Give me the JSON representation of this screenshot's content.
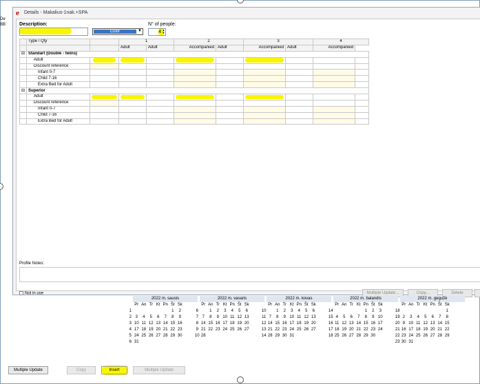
{
  "dialog": {
    "title": "Details - Makalius-1nak.+SPA",
    "description_label": "Description:",
    "description_value": "",
    "color_label": "Color",
    "people_label": "N° of people:",
    "people_value": "4"
  },
  "side": {
    "line1": "De",
    "line2": "BB"
  },
  "grid": {
    "type_qty": "Type / Qty",
    "cols": [
      "1",
      "2",
      "3",
      "4"
    ],
    "sub": [
      "Adult",
      "Adult",
      "Accompanied",
      "Adult",
      "Accompanied",
      "Adult",
      "Accompanied"
    ],
    "sections": [
      {
        "name": "Standart (Double - twins)",
        "rows": [
          "Adult",
          "Discount reference",
          "Infant 0-7",
          "Child 7-16",
          "Extra Bed for Adult"
        ]
      },
      {
        "name": "Superior",
        "rows": [
          "Adult",
          "Discount reference",
          "Infant 0-7",
          "Child 7-16",
          "Extra Bed for Adult"
        ]
      }
    ]
  },
  "profile_notes_label": "Profile Notes:",
  "not_in_use_label": "Not in use",
  "dialog_buttons": {
    "multiple_update": "Multiple Update...",
    "copy": "Copy...",
    "delete": "Delete"
  },
  "calendars": [
    {
      "title": "2022 m. sausis",
      "weeks": [
        [
          "",
          "",
          "",
          "",
          "",
          "1",
          "2"
        ],
        [
          "3",
          "4",
          "5",
          "6",
          "7",
          "8",
          "9"
        ],
        [
          "10",
          "11",
          "12",
          "13",
          "14",
          "15",
          "16"
        ],
        [
          "17",
          "18",
          "19",
          "20",
          "21",
          "22",
          "23"
        ],
        [
          "24",
          "25",
          "26",
          "27",
          "28",
          "29",
          "30"
        ],
        [
          "31",
          "",
          "",
          "",
          "",
          "",
          ""
        ]
      ],
      "nums": [
        "1",
        "2",
        "3",
        "4",
        "5",
        "6"
      ]
    },
    {
      "title": "2022 m. vasaris",
      "weeks": [
        [
          "",
          "1",
          "2",
          "3",
          "4",
          "5",
          "6"
        ],
        [
          "7",
          "8",
          "9",
          "10",
          "11",
          "12",
          "13"
        ],
        [
          "14",
          "15",
          "16",
          "17",
          "18",
          "19",
          "20"
        ],
        [
          "21",
          "22",
          "23",
          "24",
          "25",
          "26",
          "27"
        ],
        [
          "28",
          "",
          "",
          "",
          "",
          "",
          ""
        ]
      ],
      "nums": [
        "6",
        "7",
        "8",
        "9",
        "10"
      ]
    },
    {
      "title": "2022 m. kovas",
      "weeks": [
        [
          "",
          "1",
          "2",
          "3",
          "4",
          "5",
          "6"
        ],
        [
          "7",
          "8",
          "9",
          "10",
          "11",
          "12",
          "13"
        ],
        [
          "14",
          "15",
          "16",
          "17",
          "18",
          "19",
          "20"
        ],
        [
          "21",
          "22",
          "23",
          "24",
          "25",
          "26",
          "27"
        ],
        [
          "28",
          "29",
          "30",
          "31",
          "",
          "",
          ""
        ]
      ],
      "nums": [
        "10",
        "11",
        "12",
        "13",
        "14"
      ]
    },
    {
      "title": "2022 m. balandis",
      "weeks": [
        [
          "",
          "",
          "",
          "",
          "1",
          "2",
          "3"
        ],
        [
          "4",
          "5",
          "6",
          "7",
          "8",
          "9",
          "10"
        ],
        [
          "11",
          "12",
          "13",
          "14",
          "15",
          "16",
          "17"
        ],
        [
          "18",
          "19",
          "20",
          "21",
          "22",
          "23",
          "24"
        ],
        [
          "25",
          "26",
          "27",
          "28",
          "29",
          "30",
          ""
        ]
      ],
      "nums": [
        "14",
        "15",
        "16",
        "17",
        "18"
      ]
    },
    {
      "title": "2022 m. gegužė",
      "weeks": [
        [
          "",
          "",
          "",
          "",
          "",
          "",
          "1"
        ],
        [
          "2",
          "3",
          "4",
          "5",
          "6",
          "7",
          "8"
        ],
        [
          "9",
          "10",
          "11",
          "12",
          "13",
          "14",
          "15"
        ],
        [
          "16",
          "17",
          "18",
          "19",
          "20",
          "21",
          "22"
        ],
        [
          "23",
          "24",
          "25",
          "26",
          "27",
          "28",
          "29"
        ],
        [
          "30",
          "31",
          "",
          "",
          "",
          "",
          ""
        ]
      ],
      "nums": [
        "18",
        "19",
        "20",
        "21",
        "22",
        "23"
      ]
    }
  ],
  "dow": [
    "Pr",
    "An",
    "Tr",
    "Kt",
    "Pn",
    "Št",
    "Sk"
  ],
  "bottom_buttons": {
    "multiple_update": "Multiple Update",
    "copy": "Copy",
    "insert": "Insert",
    "multiple_update2": "Multiple Update"
  }
}
